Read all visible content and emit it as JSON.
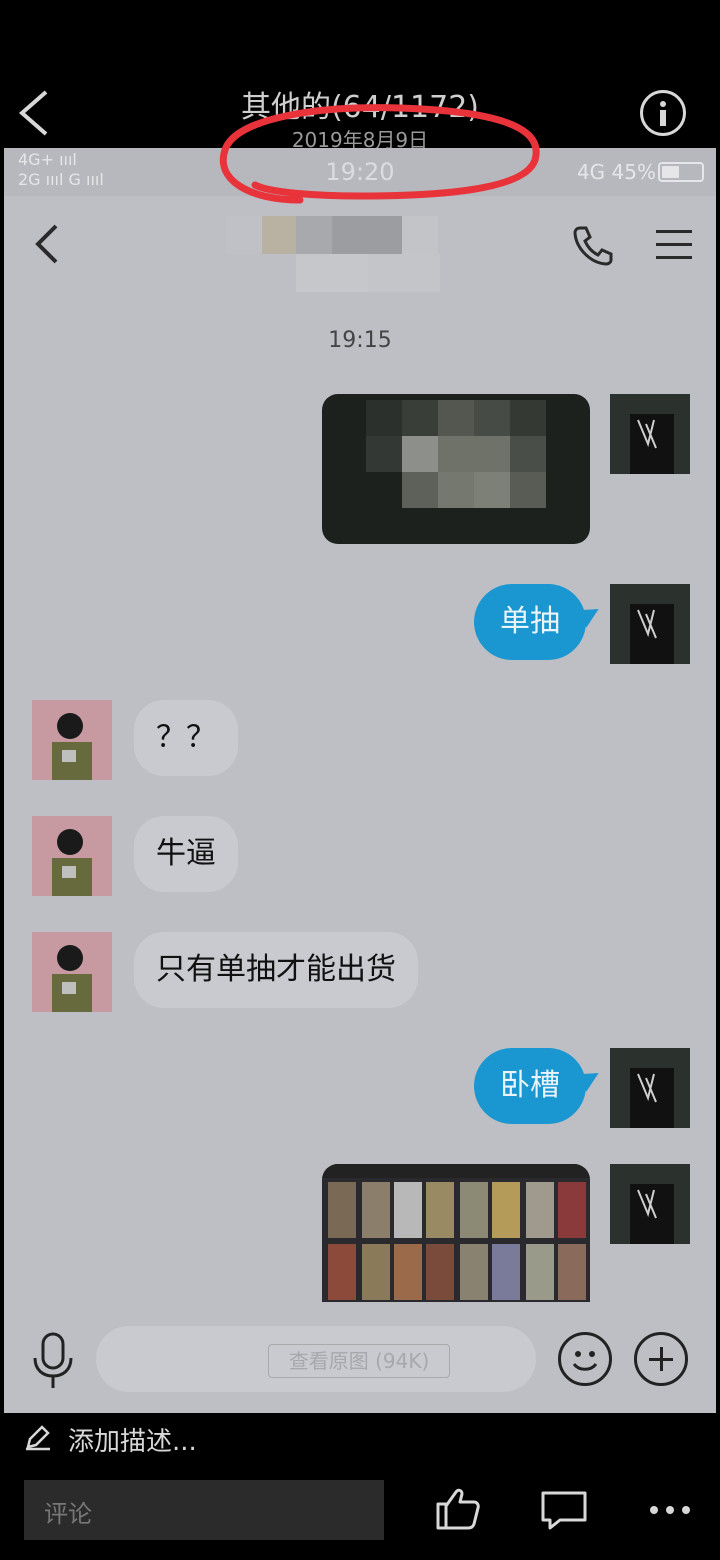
{
  "viewer": {
    "title": "其他的(64/1172)",
    "date": "2019年8月9日",
    "description_prompt": "添加描述...",
    "comment_placeholder": "评论",
    "accent_red": "#e8333a"
  },
  "status_bar": {
    "signal_line1": "4G+ ıııl",
    "signal_line2": "2G ıııl  G ıııl",
    "time": "19:20",
    "network": "4G",
    "battery": "45%",
    "battery_level": 0.45
  },
  "chat": {
    "time_divider": "19:15",
    "messages": [
      {
        "side": "out",
        "type": "image"
      },
      {
        "side": "out",
        "type": "text",
        "text": "单抽"
      },
      {
        "side": "in",
        "type": "text",
        "text": "？？"
      },
      {
        "side": "in",
        "type": "text",
        "text": "牛逼"
      },
      {
        "side": "in",
        "type": "text",
        "text": "只有单抽才能出货"
      },
      {
        "side": "out",
        "type": "text",
        "text": "卧槽"
      },
      {
        "side": "out",
        "type": "image"
      }
    ],
    "bubble_color": "#1a96d1"
  },
  "input_bar": {
    "view_original": "查看原图 (94K)"
  }
}
